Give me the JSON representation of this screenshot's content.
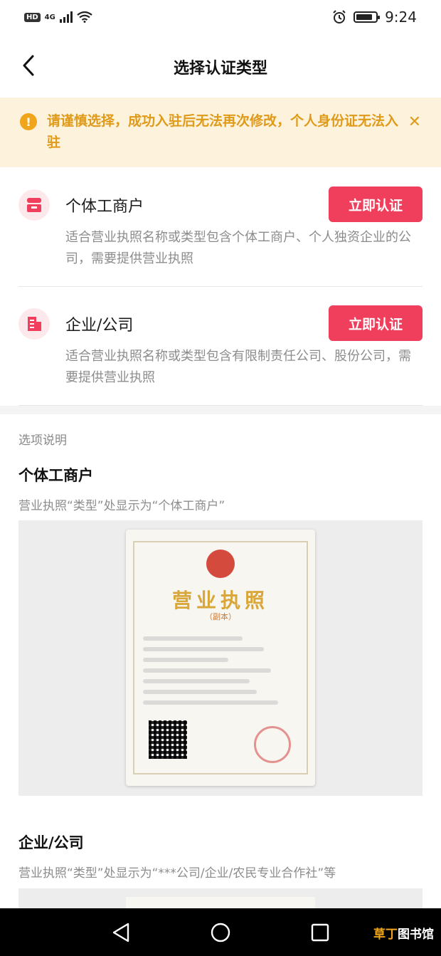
{
  "status_bar": {
    "left_badge": "HD",
    "network": "4G",
    "time": "9:24"
  },
  "nav": {
    "title": "选择认证类型",
    "back_icon": "chevron-left-icon"
  },
  "notice": {
    "icon": "warning-icon",
    "text": "请谨慎选择，成功入驻后无法再次修改，个人身份证无法入驻",
    "close_icon": "close-icon"
  },
  "options": [
    {
      "icon": "shop-icon",
      "title": "个体工商户",
      "button": "立即认证",
      "desc": "适合营业执照名称或类型包含个体工商户、个人独资企业的公司，需要提供营业执照"
    },
    {
      "icon": "building-icon",
      "title": "企业/公司",
      "button": "立即认证",
      "desc": "适合营业执照名称或类型包含有限制责任公司、股份公司，需要提供营业执照"
    }
  ],
  "explain": {
    "label": "选项说明",
    "items": [
      {
        "title": "个体工商户",
        "desc": "营业执照“类型”处显示为“个体工商户”",
        "license_title": "营业执照",
        "license_sub": "（副本）"
      },
      {
        "title": "企业/公司",
        "desc": "营业执照“类型”处显示为“***公司/企业/农民专业合作社”等"
      }
    ]
  },
  "system_nav": {
    "back": "back-triangle-icon",
    "home": "home-circle-icon",
    "recent": "recent-square-icon"
  },
  "watermark": {
    "part_a": "草丁",
    "part_b": "图书馆"
  },
  "colors": {
    "accent": "#f03e5d",
    "notice_bg": "#fdf3dc",
    "notice_text": "#e09a1a"
  }
}
